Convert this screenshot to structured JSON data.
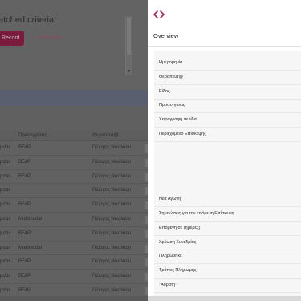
{
  "background": {
    "heading": "atched criteria!",
    "record_button": "Record",
    "import_link": "Import Data",
    "table": {
      "columns": [
        "",
        "Προσεγγίσεις",
        "Θεραπευτ@"
      ],
      "rows": [
        [
          "pσαι",
          "BE∂P",
          "Γιώργος Νικολάου"
        ],
        [
          "pσαι",
          "BE∂P",
          "Γιώργος Νικολάου"
        ],
        [
          "pσαι",
          "BE∂P",
          "Γιώργος Νικολάου"
        ],
        [
          "pσαι",
          "",
          "Γιώργος Νικολάου"
        ],
        [
          "pσαι",
          "BE∂P",
          "Γιώργος Νικολάου"
        ],
        [
          "pσαι",
          "Multimodal",
          "Γιώργος Νικολάου"
        ],
        [
          "pσαι",
          "BE∂P",
          "Γιώργος Νικολάου"
        ],
        [
          "pσαι",
          "Multimodal",
          "Γιώργος Νικολάου"
        ],
        [
          "pσαι",
          "BE∂P",
          "Γιώργος Νικολάου"
        ],
        [
          "pσαι",
          "BE∂P",
          "Γιώργος Νικολάου"
        ],
        [
          "pσαι",
          "BE∂P",
          "Γιώργος Νικολάου"
        ]
      ]
    }
  },
  "panel": {
    "icon": "code-icon",
    "title": "Overview",
    "accent_color": "#b0205a",
    "fields": [
      "Ημερομηνία",
      "Θεραπευτ@",
      "Είδος",
      "Προσεγγίσεις",
      "Χειρόγραφη σελίδα",
      "Περιεχόμενο Επίσκεψης",
      "Νέα Αγωγή",
      "Σημειώσεις για την επόμενη Επίσκεψη",
      "Επόμενη σε (ημέρες)",
      "Χρέωση Συνεδρίας",
      "Πληρώθηκε",
      "Τρόπος Πληρωμής",
      "\"Αόρατη\""
    ]
  }
}
